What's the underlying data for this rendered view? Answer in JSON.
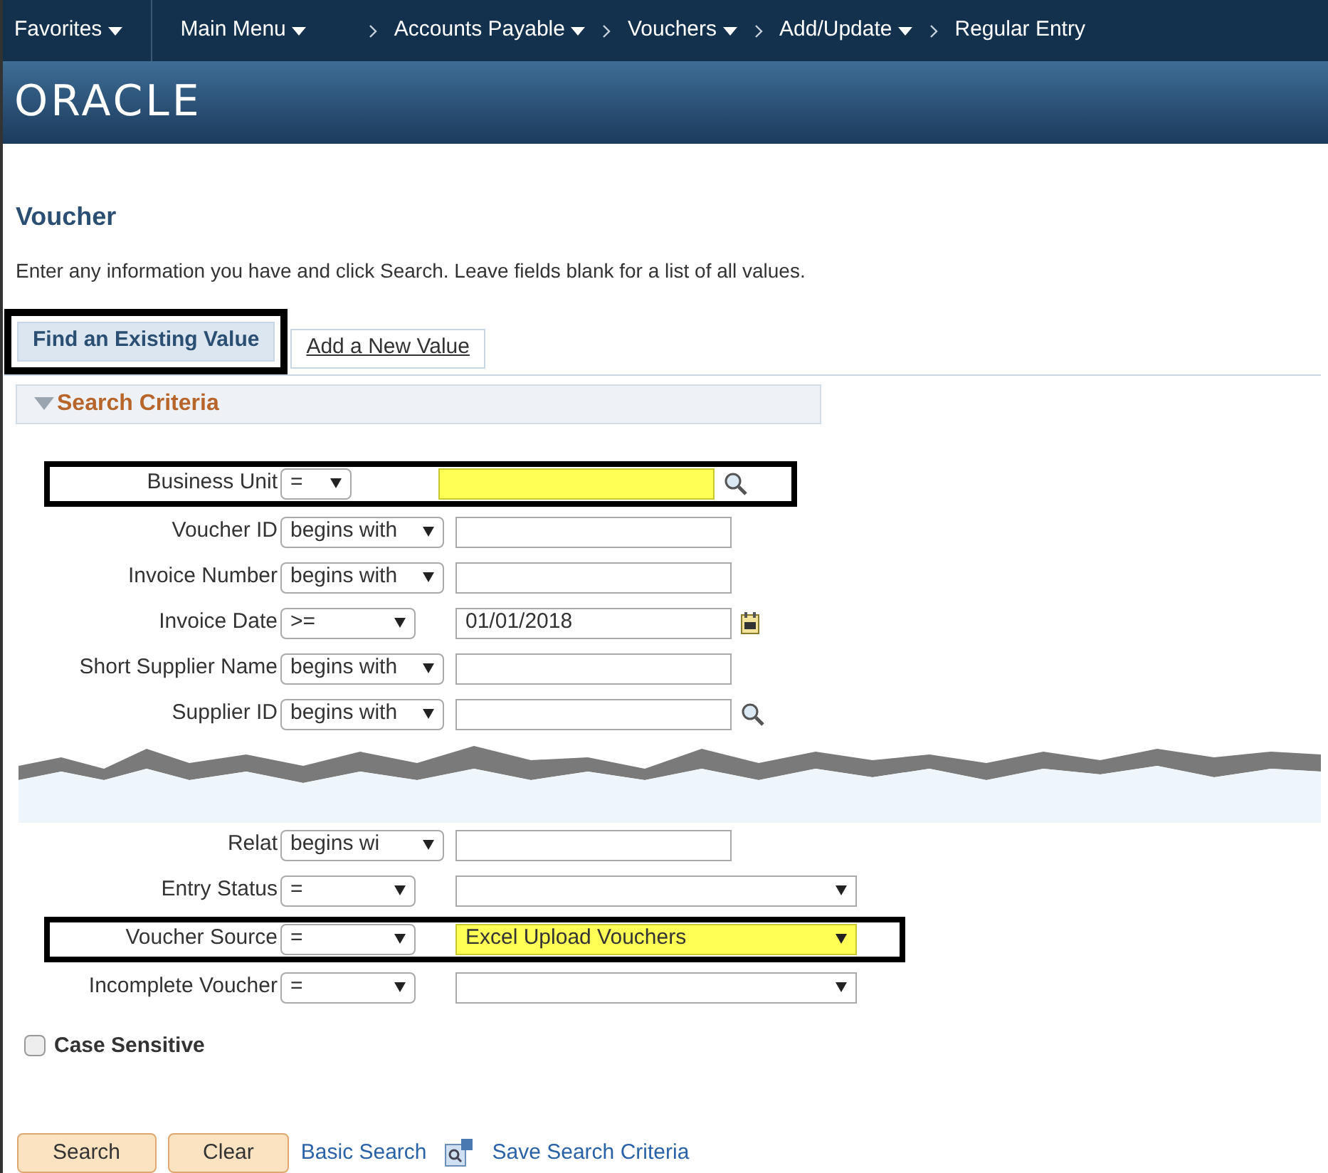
{
  "nav": {
    "items": [
      {
        "label": "Favorites",
        "kind": "menu"
      },
      {
        "label": "Main Menu",
        "kind": "menu"
      },
      {
        "label": "Accounts Payable",
        "kind": "crumb-menu"
      },
      {
        "label": "Vouchers",
        "kind": "crumb-menu"
      },
      {
        "label": "Add/Update",
        "kind": "crumb-menu"
      },
      {
        "label": "Regular Entry",
        "kind": "crumb"
      }
    ]
  },
  "banner": {
    "logo": "ORACLE"
  },
  "page": {
    "title": "Voucher",
    "instructions": "Enter any information you have and click Search. Leave fields blank for a list of all values."
  },
  "tabs": [
    {
      "label": "Find an Existing Value",
      "selected": true,
      "highlighted": true
    },
    {
      "label": "Add a New Value",
      "selected": false,
      "highlighted": false
    }
  ],
  "section": {
    "title": "Search Criteria",
    "expanded": true
  },
  "rows": [
    {
      "label": "Business Unit",
      "kind": "code",
      "operator": "=",
      "value": "",
      "required": true,
      "highlighted": true
    },
    {
      "label": "Voucher ID",
      "kind": "text",
      "operator": "begins with",
      "value": "",
      "required": false,
      "highlighted": false
    },
    {
      "label": "Invoice Number",
      "kind": "text",
      "operator": "begins with",
      "value": "",
      "required": false,
      "highlighted": false
    },
    {
      "label": "Invoice Date",
      "kind": "date",
      "operator": ">=",
      "value": "01/01/2018",
      "required": false,
      "highlighted": false
    },
    {
      "label": "Short Supplier Name",
      "kind": "text",
      "operator": "begins with",
      "value": "",
      "required": false,
      "highlighted": false
    },
    {
      "label": "Supplier ID",
      "kind": "lookup",
      "operator": "begins with",
      "value": "",
      "required": false,
      "highlighted": false
    },
    {
      "kind": "tear"
    },
    {
      "label": "Relat",
      "kind": "text",
      "operator": "begins wi",
      "value": "",
      "required": false,
      "highlighted": false
    },
    {
      "label": "Entry Status",
      "kind": "select",
      "operator": "=",
      "value": "",
      "required": false,
      "highlighted": false
    },
    {
      "label": "Voucher Source",
      "kind": "select",
      "operator": "=",
      "value": "Excel Upload Vouchers",
      "required": true,
      "highlighted": true
    },
    {
      "label": "Incomplete Voucher",
      "kind": "select",
      "operator": "=",
      "value": "",
      "required": false,
      "highlighted": false
    }
  ],
  "case_sensitive": {
    "label": "Case Sensitive",
    "checked": false
  },
  "actions": [
    {
      "label": "Search",
      "kind": "button"
    },
    {
      "label": "Clear",
      "kind": "button"
    },
    {
      "label": "Basic Search",
      "kind": "link"
    },
    {
      "label": "Save Search Criteria",
      "kind": "icon-link"
    }
  ]
}
